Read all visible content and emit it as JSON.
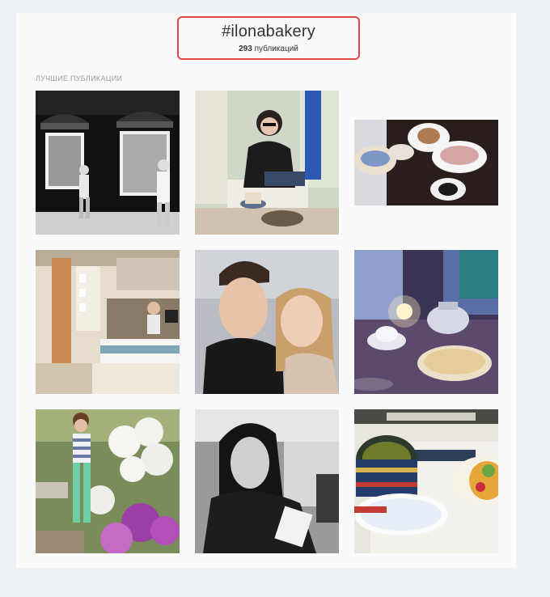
{
  "hashtag": {
    "title": "#ilonabakery",
    "count": "293",
    "count_suffix": "публикаций"
  },
  "section": {
    "label": "ЛУЧШИЕ ПУБЛИКАЦИИ"
  },
  "posts": [
    {
      "name": "post-bakery-storefront-bw"
    },
    {
      "name": "post-woman-cafe-sofa"
    },
    {
      "name": "post-coffee-and-pastries"
    },
    {
      "name": "post-bakery-interior-counter"
    },
    {
      "name": "post-couple-selfie"
    },
    {
      "name": "post-teapot-candle-table"
    },
    {
      "name": "post-woman-flowers"
    },
    {
      "name": "post-girl-selfie-bw"
    },
    {
      "name": "post-coffee-cup-tart"
    }
  ],
  "colors": {
    "highlight_border": "#e04848",
    "panel_background": "#fafafa",
    "page_background": "#eef1f6"
  }
}
